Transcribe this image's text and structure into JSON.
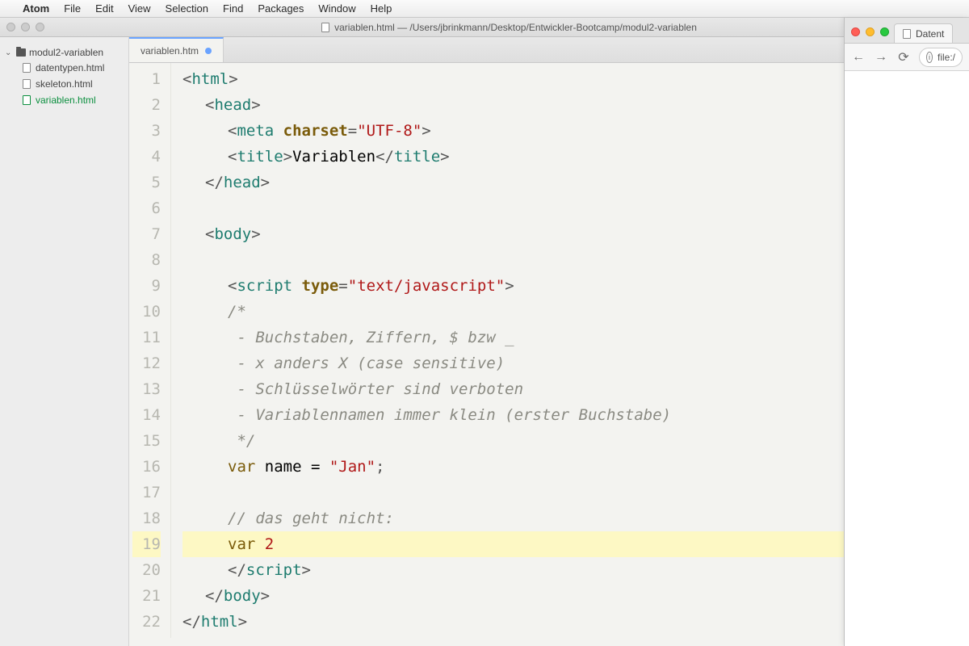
{
  "menubar": {
    "apple": "",
    "app": "Atom",
    "items": [
      "File",
      "Edit",
      "View",
      "Selection",
      "Find",
      "Packages",
      "Window",
      "Help"
    ]
  },
  "window": {
    "title": "variablen.html — /Users/jbrinkmann/Desktop/Entwickler-Bootcamp/modul2-variablen"
  },
  "sidebar": {
    "root": "modul2-variablen",
    "files": [
      {
        "name": "datentypen.html",
        "active": false
      },
      {
        "name": "skeleton.html",
        "active": false
      },
      {
        "name": "variablen.html",
        "active": true
      }
    ]
  },
  "tab": {
    "label": "variablen.htm",
    "modified": true
  },
  "code": {
    "highlighted_line": 19,
    "lines": [
      {
        "n": 1,
        "indent": 1,
        "tokens": [
          [
            "<",
            "punct"
          ],
          [
            "html",
            "tag"
          ],
          [
            ">",
            "punct"
          ]
        ]
      },
      {
        "n": 2,
        "indent": 2,
        "tokens": [
          [
            "<",
            "punct"
          ],
          [
            "head",
            "tag"
          ],
          [
            ">",
            "punct"
          ]
        ]
      },
      {
        "n": 3,
        "indent": 3,
        "tokens": [
          [
            "<",
            "punct"
          ],
          [
            "meta ",
            "tag"
          ],
          [
            "charset",
            "attr"
          ],
          [
            "=",
            "punct"
          ],
          [
            "\"UTF-8\"",
            "str"
          ],
          [
            ">",
            "punct"
          ]
        ]
      },
      {
        "n": 4,
        "indent": 3,
        "tokens": [
          [
            "<",
            "punct"
          ],
          [
            "title",
            "tag"
          ],
          [
            ">",
            "punct"
          ],
          [
            "Variablen",
            "plain"
          ],
          [
            "</",
            "punct"
          ],
          [
            "title",
            "tag"
          ],
          [
            ">",
            "punct"
          ]
        ]
      },
      {
        "n": 5,
        "indent": 2,
        "tokens": [
          [
            "</",
            "punct"
          ],
          [
            "head",
            "tag"
          ],
          [
            ">",
            "punct"
          ]
        ]
      },
      {
        "n": 6,
        "indent": 1,
        "tokens": []
      },
      {
        "n": 7,
        "indent": 2,
        "tokens": [
          [
            "<",
            "punct"
          ],
          [
            "body",
            "tag"
          ],
          [
            ">",
            "punct"
          ]
        ]
      },
      {
        "n": 8,
        "indent": 1,
        "tokens": []
      },
      {
        "n": 9,
        "indent": 3,
        "tokens": [
          [
            "<",
            "punct"
          ],
          [
            "script ",
            "tag"
          ],
          [
            "type",
            "attr"
          ],
          [
            "=",
            "punct"
          ],
          [
            "\"text/javascript\"",
            "str"
          ],
          [
            ">",
            "punct"
          ]
        ]
      },
      {
        "n": 10,
        "indent": 3,
        "tokens": [
          [
            "/*",
            "comment"
          ]
        ]
      },
      {
        "n": 11,
        "indent": 3,
        "tokens": [
          [
            " - Buchstaben, Ziffern, $ bzw _",
            "comment"
          ]
        ]
      },
      {
        "n": 12,
        "indent": 3,
        "tokens": [
          [
            " - x anders X (case sensitive)",
            "comment"
          ]
        ]
      },
      {
        "n": 13,
        "indent": 3,
        "tokens": [
          [
            " - Schlüsselwörter sind verboten",
            "comment"
          ]
        ]
      },
      {
        "n": 14,
        "indent": 3,
        "tokens": [
          [
            " - Variablennamen immer klein (erster Buchstabe)",
            "comment"
          ]
        ]
      },
      {
        "n": 15,
        "indent": 3,
        "tokens": [
          [
            " */",
            "comment"
          ]
        ]
      },
      {
        "n": 16,
        "indent": 3,
        "tokens": [
          [
            "var ",
            "kw"
          ],
          [
            "name = ",
            "plain"
          ],
          [
            "\"Jan\"",
            "str"
          ],
          [
            ";",
            "punct"
          ]
        ]
      },
      {
        "n": 17,
        "indent": 1,
        "tokens": []
      },
      {
        "n": 18,
        "indent": 3,
        "tokens": [
          [
            "// das geht nicht:",
            "comment"
          ]
        ]
      },
      {
        "n": 19,
        "indent": 3,
        "tokens": [
          [
            "var ",
            "kw"
          ],
          [
            "2",
            "num"
          ]
        ]
      },
      {
        "n": 20,
        "indent": 3,
        "tokens": [
          [
            "</",
            "punct"
          ],
          [
            "script",
            "tag"
          ],
          [
            ">",
            "punct"
          ]
        ]
      },
      {
        "n": 21,
        "indent": 2,
        "tokens": [
          [
            "</",
            "punct"
          ],
          [
            "body",
            "tag"
          ],
          [
            ">",
            "punct"
          ]
        ]
      },
      {
        "n": 22,
        "indent": 1,
        "tokens": [
          [
            "</",
            "punct"
          ],
          [
            "html",
            "tag"
          ],
          [
            ">",
            "punct"
          ]
        ]
      }
    ]
  },
  "browser": {
    "tab_label": "Datent",
    "address_prefix": "file:/"
  }
}
